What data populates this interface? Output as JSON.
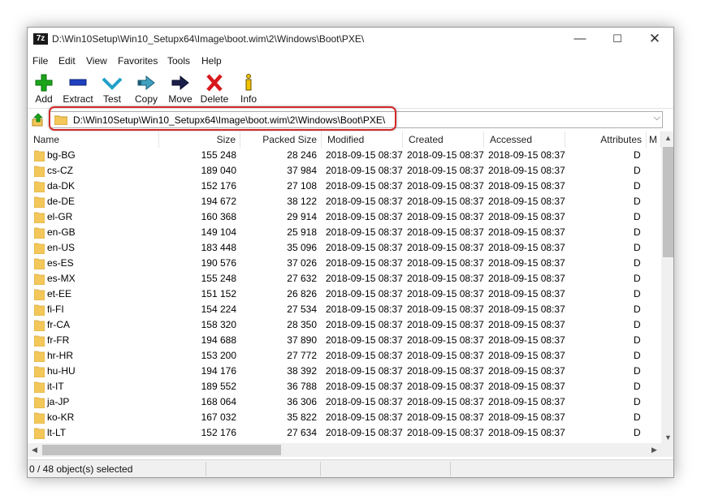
{
  "window": {
    "title": "D:\\Win10Setup\\Win10_Setupx64\\Image\\boot.wim\\2\\Windows\\Boot\\PXE\\",
    "app_icon_text": "7z",
    "minimize_glyph": "—",
    "maximize_glyph": "☐",
    "close_glyph": "✕"
  },
  "menu": [
    "File",
    "Edit",
    "View",
    "Favorites",
    "Tools",
    "Help"
  ],
  "toolbar": [
    {
      "label": "Add",
      "icon": "add-icon"
    },
    {
      "label": "Extract",
      "icon": "extract-icon"
    },
    {
      "label": "Test",
      "icon": "test-icon"
    },
    {
      "label": "Copy",
      "icon": "copy-icon"
    },
    {
      "label": "Move",
      "icon": "move-icon"
    },
    {
      "label": "Delete",
      "icon": "delete-icon"
    },
    {
      "label": "Info",
      "icon": "info-icon"
    }
  ],
  "address": {
    "path": "D:\\Win10Setup\\Win10_Setupx64\\Image\\boot.wim\\2\\Windows\\Boot\\PXE\\",
    "dropdown_glyph": "⌵"
  },
  "columns": [
    "Name",
    "Size",
    "Packed Size",
    "Modified",
    "Created",
    "Accessed",
    "Attributes",
    "M"
  ],
  "rows": [
    {
      "name": "bg-BG",
      "size": "155 248",
      "packed": "28 246",
      "modified": "2018-09-15 08:37",
      "created": "2018-09-15 08:37",
      "accessed": "2018-09-15 08:37",
      "attr": "D"
    },
    {
      "name": "cs-CZ",
      "size": "189 040",
      "packed": "37 984",
      "modified": "2018-09-15 08:37",
      "created": "2018-09-15 08:37",
      "accessed": "2018-09-15 08:37",
      "attr": "D"
    },
    {
      "name": "da-DK",
      "size": "152 176",
      "packed": "27 108",
      "modified": "2018-09-15 08:37",
      "created": "2018-09-15 08:37",
      "accessed": "2018-09-15 08:37",
      "attr": "D"
    },
    {
      "name": "de-DE",
      "size": "194 672",
      "packed": "38 122",
      "modified": "2018-09-15 08:37",
      "created": "2018-09-15 08:37",
      "accessed": "2018-09-15 08:37",
      "attr": "D"
    },
    {
      "name": "el-GR",
      "size": "160 368",
      "packed": "29 914",
      "modified": "2018-09-15 08:37",
      "created": "2018-09-15 08:37",
      "accessed": "2018-09-15 08:37",
      "attr": "D"
    },
    {
      "name": "en-GB",
      "size": "149 104",
      "packed": "25 918",
      "modified": "2018-09-15 08:37",
      "created": "2018-09-15 08:37",
      "accessed": "2018-09-15 08:37",
      "attr": "D"
    },
    {
      "name": "en-US",
      "size": "183 448",
      "packed": "35 096",
      "modified": "2018-09-15 08:37",
      "created": "2018-09-15 08:37",
      "accessed": "2018-09-15 08:37",
      "attr": "D"
    },
    {
      "name": "es-ES",
      "size": "190 576",
      "packed": "37 026",
      "modified": "2018-09-15 08:37",
      "created": "2018-09-15 08:37",
      "accessed": "2018-09-15 08:37",
      "attr": "D"
    },
    {
      "name": "es-MX",
      "size": "155 248",
      "packed": "27 632",
      "modified": "2018-09-15 08:37",
      "created": "2018-09-15 08:37",
      "accessed": "2018-09-15 08:37",
      "attr": "D"
    },
    {
      "name": "et-EE",
      "size": "151 152",
      "packed": "26 826",
      "modified": "2018-09-15 08:37",
      "created": "2018-09-15 08:37",
      "accessed": "2018-09-15 08:37",
      "attr": "D"
    },
    {
      "name": "fi-FI",
      "size": "154 224",
      "packed": "27 534",
      "modified": "2018-09-15 08:37",
      "created": "2018-09-15 08:37",
      "accessed": "2018-09-15 08:37",
      "attr": "D"
    },
    {
      "name": "fr-CA",
      "size": "158 320",
      "packed": "28 350",
      "modified": "2018-09-15 08:37",
      "created": "2018-09-15 08:37",
      "accessed": "2018-09-15 08:37",
      "attr": "D"
    },
    {
      "name": "fr-FR",
      "size": "194 688",
      "packed": "37 890",
      "modified": "2018-09-15 08:37",
      "created": "2018-09-15 08:37",
      "accessed": "2018-09-15 08:37",
      "attr": "D"
    },
    {
      "name": "hr-HR",
      "size": "153 200",
      "packed": "27 772",
      "modified": "2018-09-15 08:37",
      "created": "2018-09-15 08:37",
      "accessed": "2018-09-15 08:37",
      "attr": "D"
    },
    {
      "name": "hu-HU",
      "size": "194 176",
      "packed": "38 392",
      "modified": "2018-09-15 08:37",
      "created": "2018-09-15 08:37",
      "accessed": "2018-09-15 08:37",
      "attr": "D"
    },
    {
      "name": "it-IT",
      "size": "189 552",
      "packed": "36 788",
      "modified": "2018-09-15 08:37",
      "created": "2018-09-15 08:37",
      "accessed": "2018-09-15 08:37",
      "attr": "D"
    },
    {
      "name": "ja-JP",
      "size": "168 064",
      "packed": "36 306",
      "modified": "2018-09-15 08:37",
      "created": "2018-09-15 08:37",
      "accessed": "2018-09-15 08:37",
      "attr": "D"
    },
    {
      "name": "ko-KR",
      "size": "167 032",
      "packed": "35 822",
      "modified": "2018-09-15 08:37",
      "created": "2018-09-15 08:37",
      "accessed": "2018-09-15 08:37",
      "attr": "D"
    },
    {
      "name": "lt-LT",
      "size": "152 176",
      "packed": "27 634",
      "modified": "2018-09-15 08:37",
      "created": "2018-09-15 08:37",
      "accessed": "2018-09-15 08:37",
      "attr": "D"
    }
  ],
  "scrollbars": {
    "up_glyph": "▲",
    "down_glyph": "▼",
    "left_glyph": "◀",
    "right_glyph": "▶"
  },
  "status": {
    "selected_text": "0 / 48 object(s) selected"
  },
  "colors": {
    "highlight": "#d22a2a",
    "folder": "#f3c75a",
    "add_green": "#1aa51a",
    "delete_red": "#d7191c",
    "extract_blue": "#1f3fbf",
    "test_cyan": "#20a0c8",
    "info_yellow": "#f2c200"
  }
}
